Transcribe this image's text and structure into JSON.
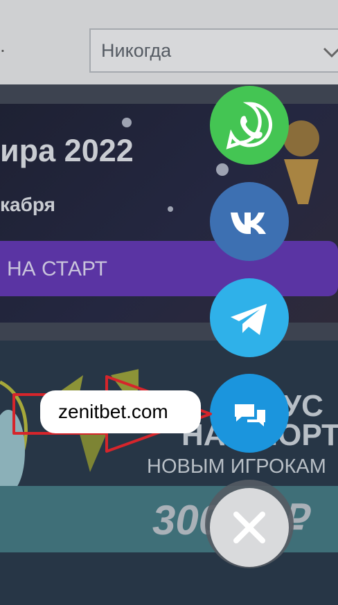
{
  "settings": {
    "select_value": "Никогда",
    "left_fragment": "."
  },
  "banner_event": {
    "title": "ира 2022",
    "date": "кабря",
    "cta_label": "НА СТАРТ"
  },
  "banner_bonus": {
    "heading_line1": "НУС",
    "heading_line2": "НА СПОРТ",
    "subheading": "НОВЫМ ИГРОКАМ",
    "amount": "30000 ₽"
  },
  "contact_menu": {
    "whatsapp_color": "#44c553",
    "vk_color": "#3d70b2",
    "telegram_color": "#2fb1e9",
    "chat_color": "#1b95dd",
    "close_color": "#d9dadc"
  },
  "annotation": {
    "label": "zenitbet.com",
    "arrow_color": "#d6252b"
  }
}
